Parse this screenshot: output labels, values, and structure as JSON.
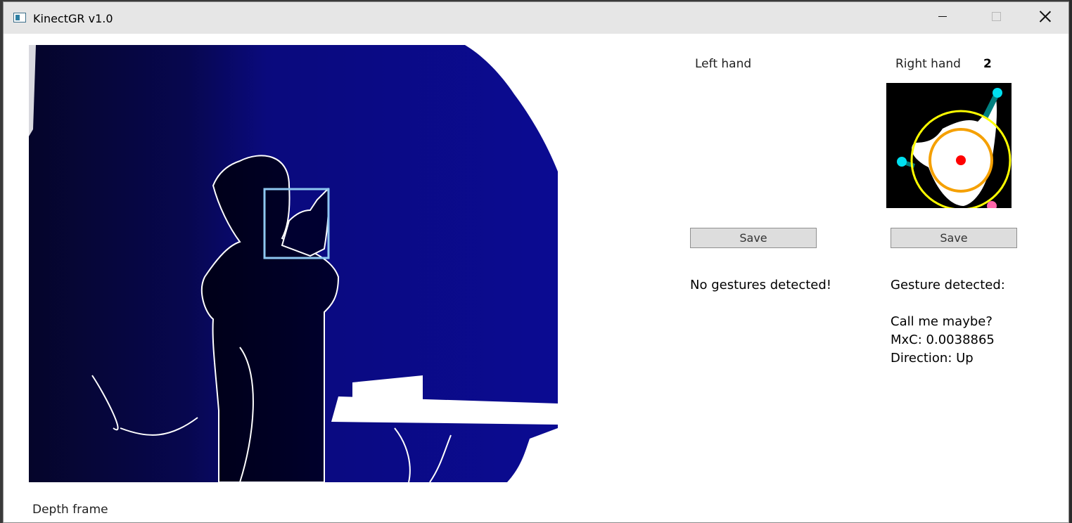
{
  "window": {
    "title": "KinectGR v1.0"
  },
  "depth": {
    "label": "Depth frame"
  },
  "left_panel": {
    "title": "Left hand",
    "save_label": "Save",
    "status": "No gestures detected!"
  },
  "right_panel": {
    "title": "Right hand",
    "count": "2",
    "save_label": "Save",
    "status": "Gesture detected:",
    "gesture_name": "Call me maybe?",
    "mxc": "MxC: 0.0038865",
    "direction": "Direction: Up"
  },
  "colors": {
    "depth_background": "#0a0a8a",
    "silhouette": "#000030",
    "roi_box": "#8ec7f0",
    "enclosing_circle": "#ffff00",
    "inner_circle": "#f5a000",
    "palm_center": "#ff0000",
    "fingertip": "#00e0f0",
    "finger_line": "#008080"
  }
}
